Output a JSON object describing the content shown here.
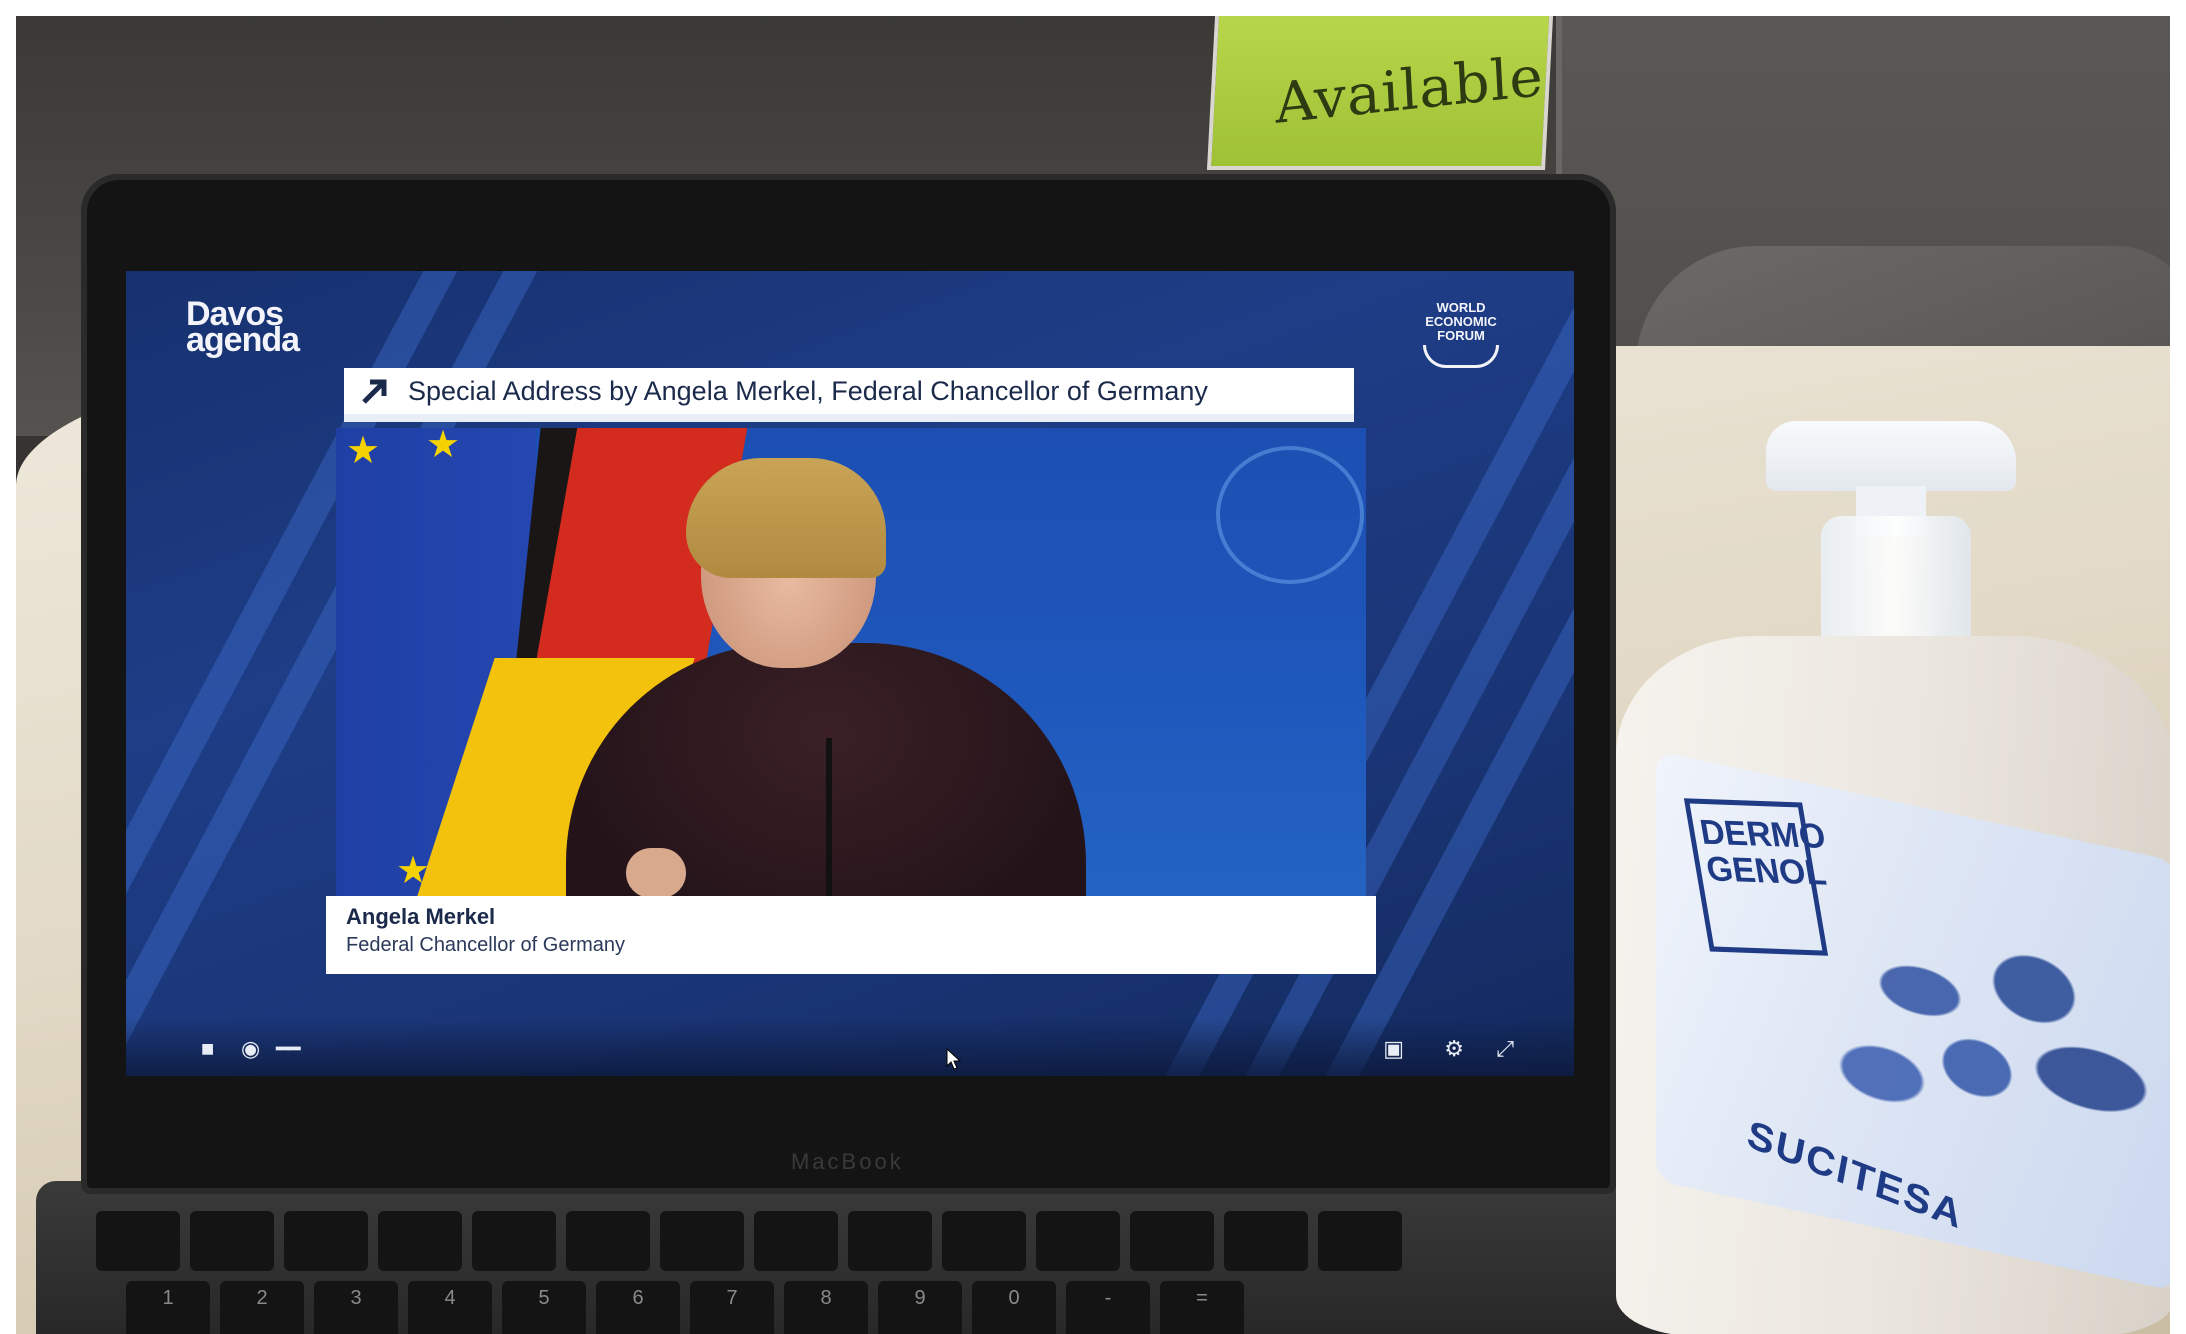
{
  "sign": {
    "text": "Available"
  },
  "screen": {
    "davos_logo_line1": "Davos",
    "davos_logo_line2": "agenda",
    "wef_logo_line1": "WORLD",
    "wef_logo_line2": "ECONOMIC",
    "wef_logo_line3": "FORUM",
    "title": "Special Address by Angela Merkel, Federal Chancellor of Germany",
    "speaker_name": "Angela Merkel",
    "speaker_role": "Federal Chancellor of Germany"
  },
  "laptop": {
    "brand": "MacBook"
  },
  "keyboard": {
    "row1": [
      "",
      "",
      "",
      "",
      "",
      "",
      "",
      "",
      "",
      "",
      "",
      "",
      "",
      ""
    ],
    "row2": [
      "1",
      "2",
      "3",
      "4",
      "5",
      "6",
      "7",
      "8",
      "9",
      "0",
      "-",
      "="
    ]
  },
  "bottle": {
    "brand_line1": "DERMO",
    "brand_line2": "GENOL",
    "maker": "SUCITESA"
  },
  "colors": {
    "screen_blue": "#1e3d86",
    "sign_green": "#b8d64a",
    "label_blue": "#1f3b86"
  }
}
